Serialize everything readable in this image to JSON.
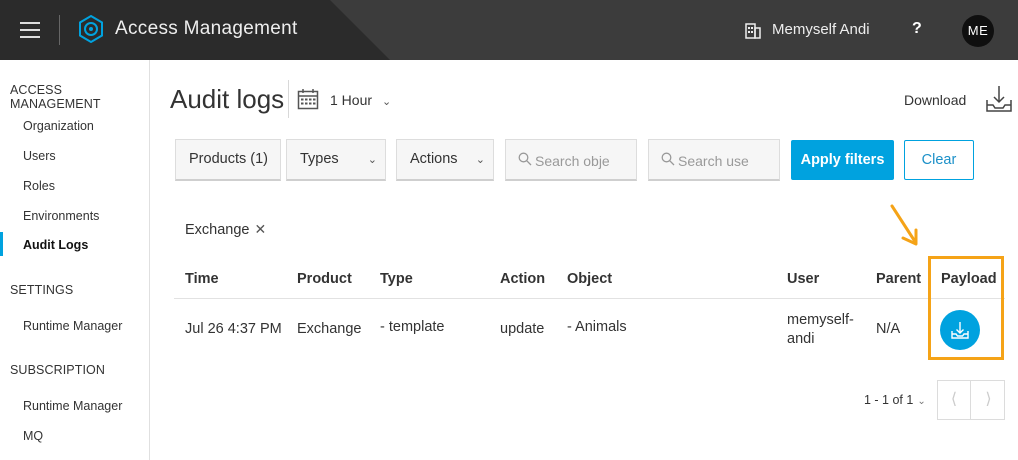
{
  "topbar": {
    "app_title": "Access Management",
    "user_name": "Memyself Andi",
    "help_label": "?",
    "avatar_initials": "ME"
  },
  "sidebar": {
    "sections": [
      {
        "heading": "ACCESS MANAGEMENT",
        "items": [
          {
            "label": "Organization",
            "active": false
          },
          {
            "label": "Users",
            "active": false
          },
          {
            "label": "Roles",
            "active": false
          },
          {
            "label": "Environments",
            "active": false
          },
          {
            "label": "Audit Logs",
            "active": true
          }
        ]
      },
      {
        "heading": "SETTINGS",
        "items": [
          {
            "label": "Runtime Manager",
            "active": false
          }
        ]
      },
      {
        "heading": "SUBSCRIPTION",
        "items": [
          {
            "label": "Runtime Manager",
            "active": false
          },
          {
            "label": "MQ",
            "active": false
          }
        ]
      }
    ]
  },
  "header": {
    "title": "Audit logs",
    "time_range": "1 Hour",
    "download_label": "Download"
  },
  "filters": {
    "products_label": "Products (1)",
    "types_label": "Types",
    "actions_label": "Actions",
    "search_object_placeholder": "Search obje",
    "search_user_placeholder": "Search use",
    "apply_label": "Apply filters",
    "clear_label": "Clear"
  },
  "active_filter_chip": "Exchange",
  "table": {
    "columns": [
      "Time",
      "Product",
      "Type",
      "Action",
      "Object",
      "User",
      "Parent",
      "Payload"
    ],
    "rows": [
      {
        "time": "Jul 26 4:37 PM",
        "product": "Exchange",
        "type": "- template",
        "action": "update",
        "object": "- Animals",
        "user_line1": "memyself-",
        "user_line2": "andi",
        "parent": "N/A"
      }
    ]
  },
  "pagination": {
    "range_text": "1 - 1 of 1"
  },
  "colors": {
    "topbar": "#2b2b2b",
    "accent": "#00a2df",
    "highlight": "#f5a317"
  },
  "icons": {
    "menu": "hamburger-icon",
    "logo": "gear-logo-icon",
    "org": "building-icon",
    "calendar": "calendar-icon",
    "download": "download-tray-icon",
    "search": "search-icon",
    "payload": "download-tray-icon",
    "annotation": "arrow-down-left-icon"
  }
}
